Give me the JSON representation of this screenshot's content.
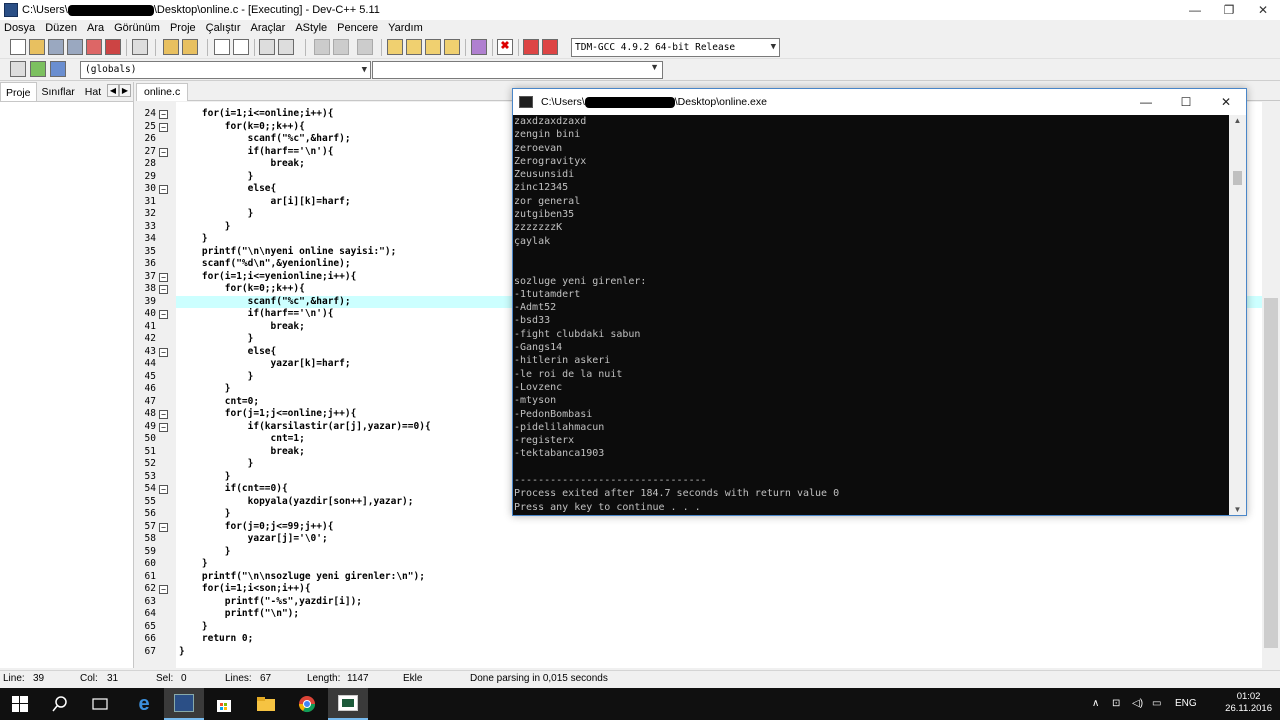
{
  "window": {
    "title_prefix": "C:\\Users\\",
    "title_suffix": "\\Desktop\\online.c - [Executing] - Dev-C++ 5.11",
    "minimize": "—",
    "maximize": "❐",
    "close": "✕"
  },
  "menu": [
    "Dosya",
    "Düzen",
    "Ara",
    "Görünüm",
    "Proje",
    "Çalıştır",
    "Araçlar",
    "AStyle",
    "Pencere",
    "Yardım"
  ],
  "toolbar": {
    "compiler": "TDM-GCC 4.9.2 64-bit Release",
    "globals": "(globals)"
  },
  "left_panel": {
    "tabs": [
      "Proje",
      "Sınıflar",
      "Hat"
    ],
    "nav_prev": "◀",
    "nav_next": "▶"
  },
  "editor": {
    "tab": "online.c",
    "highlight_line": 39,
    "lines": [
      {
        "n": "24",
        "fold": "−",
        "code": "    for(i=1;i<=online;i++){"
      },
      {
        "n": "25",
        "fold": "−",
        "code": "        for(k=0;;k++){"
      },
      {
        "n": "26",
        "fold": "",
        "code": "            scanf(\"%c\",&harf);"
      },
      {
        "n": "27",
        "fold": "−",
        "code": "            if(harf=='\\n'){"
      },
      {
        "n": "28",
        "fold": "",
        "code": "                break;"
      },
      {
        "n": "29",
        "fold": "",
        "code": "            }"
      },
      {
        "n": "30",
        "fold": "−",
        "code": "            else{"
      },
      {
        "n": "31",
        "fold": "",
        "code": "                ar[i][k]=harf;"
      },
      {
        "n": "32",
        "fold": "",
        "code": "            }"
      },
      {
        "n": "33",
        "fold": "",
        "code": "        }"
      },
      {
        "n": "34",
        "fold": "",
        "code": "    }"
      },
      {
        "n": "35",
        "fold": "",
        "code": "    printf(\"\\n\\nyeni online sayisi:\");"
      },
      {
        "n": "36",
        "fold": "",
        "code": "    scanf(\"%d\\n\",&yenionline);"
      },
      {
        "n": "37",
        "fold": "−",
        "code": "    for(i=1;i<=yenionline;i++){"
      },
      {
        "n": "38",
        "fold": "−",
        "code": "        for(k=0;;k++){"
      },
      {
        "n": "39",
        "fold": "",
        "code": "            scanf(\"%c\",&harf);"
      },
      {
        "n": "40",
        "fold": "−",
        "code": "            if(harf=='\\n'){"
      },
      {
        "n": "41",
        "fold": "",
        "code": "                break;"
      },
      {
        "n": "42",
        "fold": "",
        "code": "            }"
      },
      {
        "n": "43",
        "fold": "−",
        "code": "            else{"
      },
      {
        "n": "44",
        "fold": "",
        "code": "                yazar[k]=harf;"
      },
      {
        "n": "45",
        "fold": "",
        "code": "            }"
      },
      {
        "n": "46",
        "fold": "",
        "code": "        }"
      },
      {
        "n": "47",
        "fold": "",
        "code": "        cnt=0;"
      },
      {
        "n": "48",
        "fold": "−",
        "code": "        for(j=1;j<=online;j++){"
      },
      {
        "n": "49",
        "fold": "−",
        "code": "            if(karsilastir(ar[j],yazar)==0){"
      },
      {
        "n": "50",
        "fold": "",
        "code": "                cnt=1;"
      },
      {
        "n": "51",
        "fold": "",
        "code": "                break;"
      },
      {
        "n": "52",
        "fold": "",
        "code": "            }"
      },
      {
        "n": "53",
        "fold": "",
        "code": "        }"
      },
      {
        "n": "54",
        "fold": "−",
        "code": "        if(cnt==0){"
      },
      {
        "n": "55",
        "fold": "",
        "code": "            kopyala(yazdir[son++],yazar);"
      },
      {
        "n": "56",
        "fold": "",
        "code": "        }"
      },
      {
        "n": "57",
        "fold": "−",
        "code": "        for(j=0;j<=99;j++){"
      },
      {
        "n": "58",
        "fold": "",
        "code": "            yazar[j]='\\0';"
      },
      {
        "n": "59",
        "fold": "",
        "code": "        }"
      },
      {
        "n": "60",
        "fold": "",
        "code": "    }"
      },
      {
        "n": "61",
        "fold": "",
        "code": "    printf(\"\\n\\nsozluge yeni girenler:\\n\");"
      },
      {
        "n": "62",
        "fold": "−",
        "code": "    for(i=1;i<son;i++){"
      },
      {
        "n": "63",
        "fold": "",
        "code": "        printf(\"-%s\",yazdir[i]);"
      },
      {
        "n": "64",
        "fold": "",
        "code": "        printf(\"\\n\");"
      },
      {
        "n": "65",
        "fold": "",
        "code": "    }"
      },
      {
        "n": "66",
        "fold": "",
        "code": "    return 0;"
      },
      {
        "n": "67",
        "fold": "",
        "code": "}"
      }
    ]
  },
  "statusbar": {
    "line_label": "Line:",
    "line_value": "39",
    "col_label": "Col:",
    "col_value": "31",
    "sel_label": "Sel:",
    "sel_value": "0",
    "lines_label": "Lines:",
    "lines_value": "67",
    "length_label": "Length:",
    "length_value": "1147",
    "mode": "Ekle",
    "message": "Done parsing in 0,015 seconds"
  },
  "console": {
    "title_prefix": "C:\\Users\\",
    "title_suffix": "\\Desktop\\online.exe",
    "minimize": "—",
    "maximize": "☐",
    "close": "✕",
    "lines": [
      "zaxdzaxdzaxd",
      "zengin bini",
      "zeroevan",
      "Zerogravityx",
      "Zeusunsidi",
      "zinc12345",
      "zor general",
      "zutgiben35",
      "zzzzzzzK",
      "çaylak",
      "",
      "",
      "sozluge yeni girenler:",
      "-1tutamdert",
      "-Admt52",
      "-bsd33",
      "-fight clubdaki sabun",
      "-Gangs14",
      "-hitlerin askeri",
      "-le roi de la nuit",
      "-Lovzenc",
      "-mtyson",
      "-PedonBombasi",
      "-pidelilahmacun",
      "-registerx",
      "-tektabanca1903",
      "",
      "--------------------------------",
      "Process exited after 184.7 seconds with return value 0",
      "Press any key to continue . . ."
    ]
  },
  "taskbar": {
    "language": "ENG",
    "time": "01:02",
    "date": "26.11.2016"
  }
}
